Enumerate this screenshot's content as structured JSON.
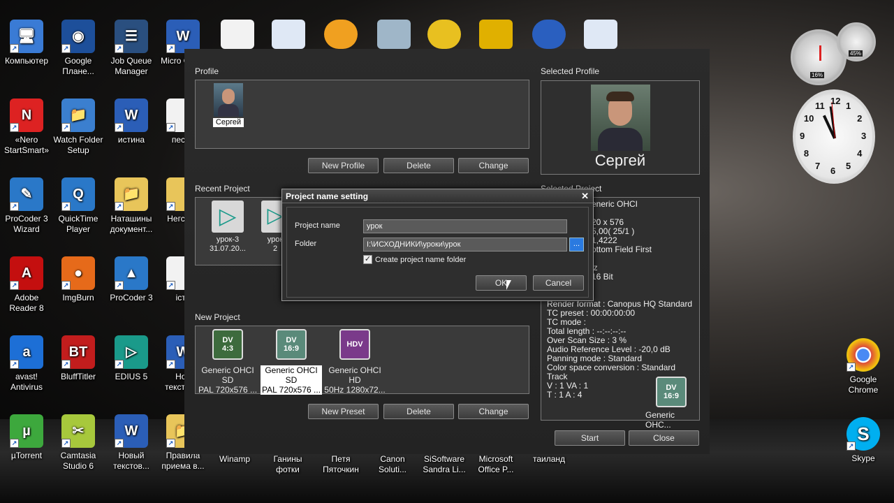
{
  "desktop": {
    "icons": [
      {
        "label": "Компьютер",
        "glyph": "🖥",
        "color": "#3a7bd5"
      },
      {
        "label": "Google Плане...",
        "glyph": "◉",
        "color": "#1d4f9a"
      },
      {
        "label": "Job Queue Manager",
        "glyph": "☰",
        "color": "#2a4f7f"
      },
      {
        "label": "Micro Office",
        "glyph": "W",
        "color": "#2b5eb7"
      },
      {
        "label": "«Nero StartSmart»",
        "glyph": "N",
        "color": "#d22"
      },
      {
        "label": "Watch Folder Setup",
        "glyph": "📁",
        "color": "#3b7fcf"
      },
      {
        "label": "истина",
        "glyph": "W",
        "color": "#2b5eb7"
      },
      {
        "label": "песня",
        "glyph": "",
        "color": "#f2f2f2"
      },
      {
        "label": "ProCoder 3 Wizard",
        "glyph": "✎",
        "color": "#2a78c8"
      },
      {
        "label": "QuickTime Player",
        "glyph": "Q",
        "color": "#2a78c8"
      },
      {
        "label": "Наташины документ...",
        "glyph": "📁",
        "color": "#e8c55a"
      },
      {
        "label": "Негс 2...",
        "glyph": "",
        "color": "#e8c55a"
      },
      {
        "label": "Adobe Reader 8",
        "glyph": "A",
        "color": "#c40f0f"
      },
      {
        "label": "ImgBurn",
        "glyph": "●",
        "color": "#e66a1a"
      },
      {
        "label": "ProCoder 3",
        "glyph": "▲",
        "color": "#2a78c8"
      },
      {
        "label": "істо",
        "glyph": "",
        "color": "#f2f2f2"
      },
      {
        "label": "avast! Antivirus",
        "glyph": "a",
        "color": "#1d6fd6"
      },
      {
        "label": "BluffTitler",
        "glyph": "BT",
        "color": "#c21d1d"
      },
      {
        "label": "EDIUS 5",
        "glyph": "▷",
        "color": "#1a9a8a"
      },
      {
        "label": "Нов текстов...",
        "glyph": "W",
        "color": "#2b5eb7"
      },
      {
        "label": "µTorrent",
        "glyph": "µ",
        "color": "#3da83d"
      },
      {
        "label": "Camtasia Studio 6",
        "glyph": "✂",
        "color": "#a7c83c"
      },
      {
        "label": "Новый текстов...",
        "glyph": "W",
        "color": "#2b5eb7"
      },
      {
        "label": "Правила приема в...",
        "glyph": "📁",
        "color": "#e8c55a"
      }
    ],
    "bottom_row": [
      "Winamp",
      "Ганины фотки",
      "Петя Пяточкин",
      "Canon Soluti...",
      "SiSoftware Sandra Li...",
      "Microsoft Office P...",
      "таиланд"
    ],
    "right_icons": [
      {
        "label": "Google Chrome",
        "glyph": "◎",
        "color": "#dd4b39"
      },
      {
        "label": "Skype",
        "glyph": "S",
        "color": "#00aff0"
      }
    ],
    "gadgets": {
      "cpu": "16%",
      "mem": "45%"
    },
    "clock_numbers": [
      "12",
      "1",
      "2",
      "3",
      "4",
      "5",
      "6",
      "7",
      "8",
      "9",
      "10",
      "11"
    ]
  },
  "app": {
    "profile_label": "Profile",
    "profile_name": "Сергей",
    "selected_profile_label": "Selected Profile",
    "selected_profile_name": "Сергей",
    "profile_buttons": {
      "new": "New Profile",
      "delete": "Delete",
      "change": "Change"
    },
    "recent_project_label": "Recent Project",
    "recent_projects": [
      {
        "name": "урок-3",
        "date": "31.07.20..."
      },
      {
        "name": "урок",
        "date": "2"
      }
    ],
    "selected_project_label": "Selected Project",
    "selected_project_info": [
      "eneric OHCI",
      "",
      "20 x 576",
      "5,00( 25/1 )",
      "1,4222",
      "ottom Field First",
      "",
      "lz",
      "16 Bit",
      "",
      "",
      "Render format : Canopus HQ Standard",
      "TC preset : 00:00:00:00",
      "TC mode :",
      "Total length : --:--:--:--",
      "Over Scan Size : 3 %",
      "Audio Reference Level : -20,0 dB",
      "Panning mode : Standard",
      "Color space conversion : Standard",
      "Track",
      "V : 1   VA : 1",
      "T : 1   A : 4"
    ],
    "selected_project_thumb": {
      "top": "DV",
      "bottom": "16:9",
      "caption": "Generic OHC..."
    },
    "new_project_label": "New Project",
    "presets": [
      {
        "top": "DV",
        "bottom": "4:3",
        "line1": "Generic OHCI SD",
        "line2": "PAL  720x576 ...",
        "color": "#3d6b3d",
        "selected": false
      },
      {
        "top": "DV",
        "bottom": "16:9",
        "line1": "Generic OHCI SD",
        "line2": "PAL  720x576 ...",
        "color": "#5a8a7a",
        "selected": true
      },
      {
        "top": "HDV",
        "bottom": "",
        "line1": "Generic OHCI HD",
        "line2": "50Hz  1280x72...",
        "color": "#7a3a8a",
        "selected": false
      }
    ],
    "preset_buttons": {
      "new": "New Preset",
      "delete": "Delete",
      "change": "Change"
    },
    "footer_buttons": {
      "start": "Start",
      "close": "Close"
    }
  },
  "dialog": {
    "title": "Project name setting",
    "close": "✕",
    "project_name_label": "Project name",
    "project_name_value": "урок",
    "folder_label": "Folder",
    "folder_value": "I:\\ИСХОДНИКИ\\уроки\\урок",
    "browse_label": "...",
    "checkbox_label": "Create project name folder",
    "checkbox_checked": true,
    "ok": "OK",
    "cancel": "Cancel"
  }
}
